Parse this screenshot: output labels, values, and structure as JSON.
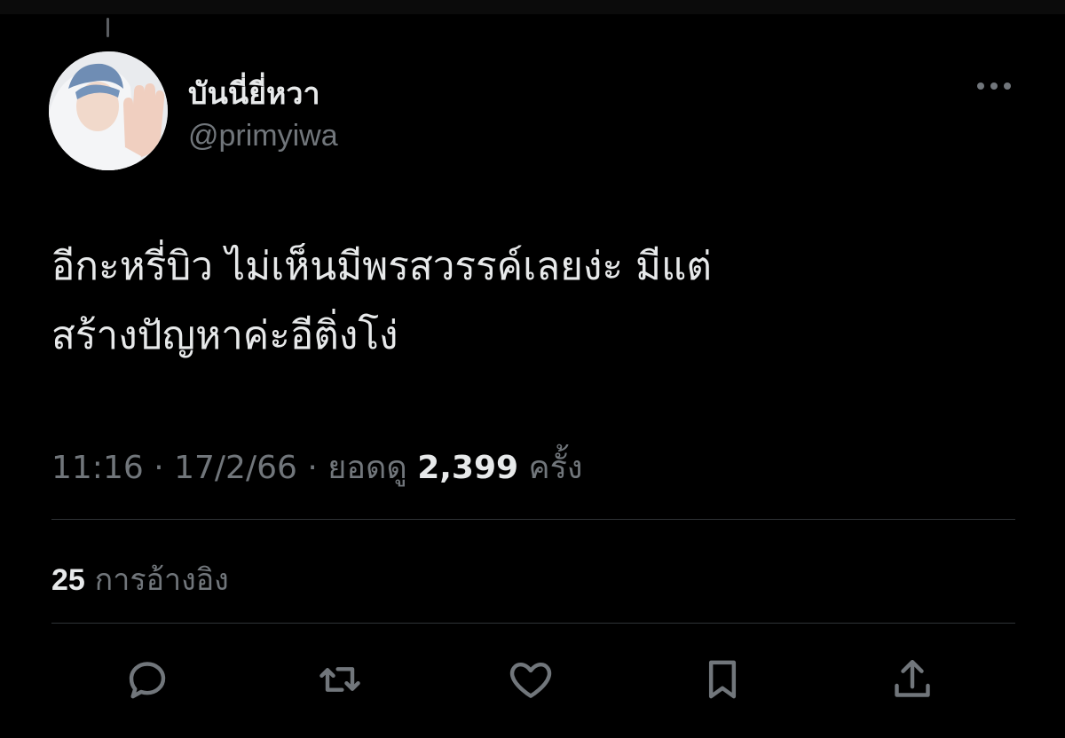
{
  "tweet": {
    "author": {
      "display_name": "บันนี่ยี่หวา",
      "handle": "@primyiwa"
    },
    "text_lines": [
      "อีกะหรี่บิว ไม่เห็นมีพรสวรรค์เลยง่ะ มีแต่",
      "สร้างปัญหาค่ะอีติ่งโง่"
    ],
    "time": "11:16",
    "separator": "·",
    "date": "17/2/66",
    "views_label": "ยอดดู",
    "views_count": "2,399",
    "views_suffix": "ครั้ง",
    "quotes_count": "25",
    "quotes_label": "การอ้างอิง"
  },
  "icons": {
    "more": "more-horizontal-icon",
    "reply": "reply-icon",
    "retweet": "retweet-icon",
    "like": "heart-icon",
    "bookmark": "bookmark-icon",
    "share": "share-icon"
  },
  "colors": {
    "background": "#000000",
    "primary_text": "#e7e9ea",
    "secondary_text": "#71767b",
    "divider": "#2f3336"
  }
}
